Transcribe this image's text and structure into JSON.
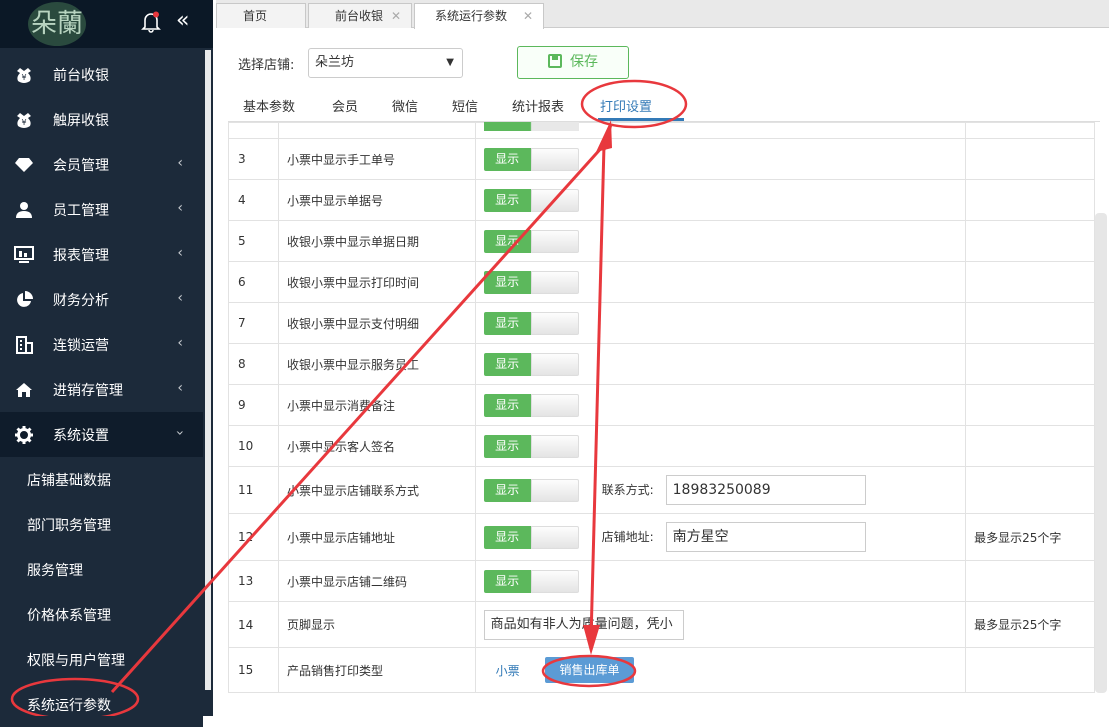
{
  "sidebar": {
    "logo_text": "朵蘭",
    "items": [
      {
        "label": "前台收银",
        "icon": "yen-icon"
      },
      {
        "label": "触屏收银",
        "icon": "yen-icon"
      },
      {
        "label": "会员管理",
        "icon": "diamond-icon"
      },
      {
        "label": "员工管理",
        "icon": "user-icon"
      },
      {
        "label": "报表管理",
        "icon": "monitor-icon"
      },
      {
        "label": "财务分析",
        "icon": "pie-icon"
      },
      {
        "label": "连锁运营",
        "icon": "building-icon"
      },
      {
        "label": "进销存管理",
        "icon": "home-icon"
      },
      {
        "label": "系统设置",
        "icon": "gear-icon"
      }
    ],
    "submenu": [
      "店铺基础数据",
      "部门职务管理",
      "服务管理",
      "价格体系管理",
      "权限与用户管理",
      "系统运行参数"
    ]
  },
  "page_tabs": [
    {
      "label": "首页"
    },
    {
      "label": "前台收银"
    },
    {
      "label": "系统运行参数"
    }
  ],
  "toolbar": {
    "store_label": "选择店铺:",
    "store_value": "朵兰坊",
    "save_label": "保存"
  },
  "sub_tabs": [
    "基本参数",
    "会员",
    "微信",
    "短信",
    "统计报表",
    "打印设置"
  ],
  "rows": [
    {
      "no": "3",
      "name": "小票中显示手工单号",
      "toggle": "显示"
    },
    {
      "no": "4",
      "name": "小票中显示单据号",
      "toggle": "显示"
    },
    {
      "no": "5",
      "name": "收银小票中显示单据日期",
      "toggle": "显示"
    },
    {
      "no": "6",
      "name": "收银小票中显示打印时间",
      "toggle": "显示"
    },
    {
      "no": "7",
      "name": "收银小票中显示支付明细",
      "toggle": "显示"
    },
    {
      "no": "8",
      "name": "收银小票中显示服务员工",
      "toggle": "显示"
    },
    {
      "no": "9",
      "name": "小票中显示消费备注",
      "toggle": "显示"
    },
    {
      "no": "10",
      "name": "小票中显示客人签名",
      "toggle": "显示"
    },
    {
      "no": "11",
      "name": "小票中显示店铺联系方式",
      "toggle": "显示",
      "field_label": "联系方式:",
      "field_value": "18983250089"
    },
    {
      "no": "12",
      "name": "小票中显示店铺地址",
      "toggle": "显示",
      "field_label": "店铺地址:",
      "field_value": "南方星空",
      "note": "最多显示25个字"
    },
    {
      "no": "13",
      "name": "小票中显示店铺二维码",
      "toggle": "显示"
    },
    {
      "no": "14",
      "name": "页脚显示",
      "footer_value": "商品如有非人为质量问题，凭小",
      "note": "最多显示25个字"
    },
    {
      "no": "15",
      "name": "产品销售打印类型",
      "option_a": "小票",
      "option_b": "销售出库单"
    }
  ],
  "colors": {
    "sidebar": "#1c2a3a",
    "toggle_on": "#5cb85c",
    "accent": "#337ab7",
    "annotation": "#e8383d"
  }
}
